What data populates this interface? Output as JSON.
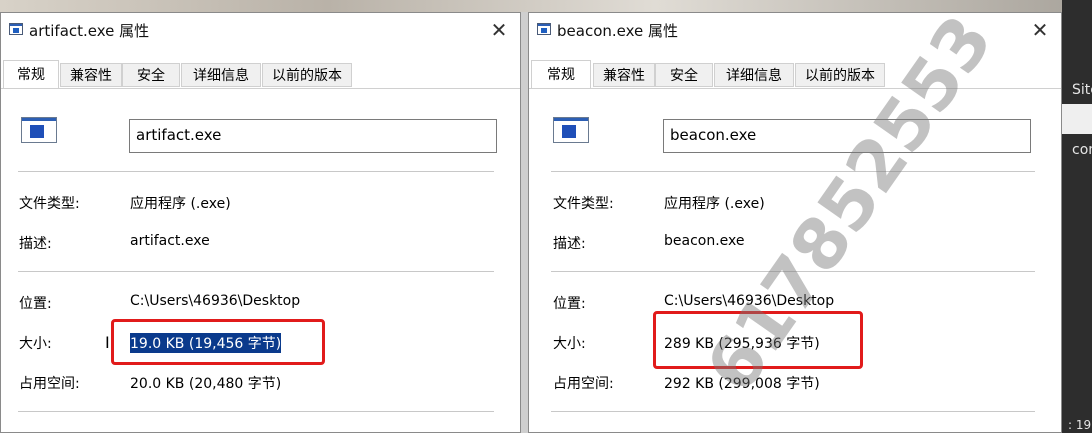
{
  "windows": [
    {
      "title": "artifact.exe 属性",
      "tabs": [
        "常规",
        "兼容性",
        "安全",
        "详细信息",
        "以前的版本"
      ],
      "active_tab": "常规",
      "filename": "artifact.exe",
      "rows": {
        "type_label": "文件类型:",
        "type_value": "应用程序 (.exe)",
        "desc_label": "描述:",
        "desc_value": "artifact.exe",
        "location_label": "位置:",
        "location_value": "C:\\Users\\46936\\Desktop",
        "size_label": "大小:",
        "size_value": "19.0 KB (19,456 字节)",
        "disk_label": "占用空间:",
        "disk_value": "20.0 KB (20,480 字节)"
      },
      "size_selected": true
    },
    {
      "title": "beacon.exe 属性",
      "tabs": [
        "常规",
        "兼容性",
        "安全",
        "详细信息",
        "以前的版本"
      ],
      "active_tab": "常规",
      "filename": "beacon.exe",
      "rows": {
        "type_label": "文件类型:",
        "type_value": "应用程序 (.exe)",
        "desc_label": "描述:",
        "desc_value": "beacon.exe",
        "location_label": "位置:",
        "location_value": "C:\\Users\\46936\\Desktop",
        "size_label": "大小:",
        "size_value": "289 KB (295,936 字节)",
        "disk_label": "占用空间:",
        "disk_value": "292 KB (299,008 字节)"
      },
      "size_selected": false
    }
  ],
  "side_panel": {
    "line1": "Site",
    "line2": "con",
    "line3": ": 19"
  },
  "watermark": "617852553",
  "icons": [
    "window-app-icon",
    "exe-file-icon",
    "close-icon",
    "camera-icon",
    "text-cursor-icon"
  ],
  "colors": {
    "highlight_box": "#e11b1b",
    "selection": "#0a3a8c"
  }
}
